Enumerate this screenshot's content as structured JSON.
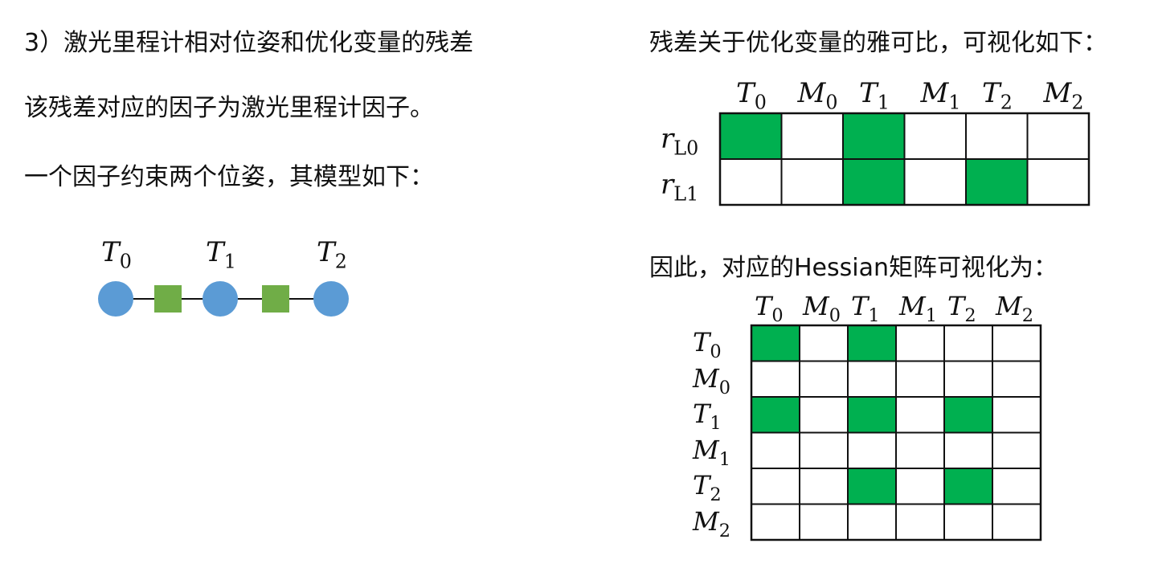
{
  "left": {
    "heading": "3）激光里程计相对位姿和优化变量的残差",
    "factor_line": "该残差对应的因子为激光里程计因子。",
    "model_line": "一个因子约束两个位姿，其模型如下："
  },
  "factor_graph": {
    "nodes": [
      {
        "sym": "T",
        "sub": "0"
      },
      {
        "sym": "T",
        "sub": "1"
      },
      {
        "sym": "T",
        "sub": "2"
      }
    ],
    "node_color": "#5b9bd5",
    "factor_color": "#70ad47"
  },
  "right": {
    "jacobian_title": "残差关于优化变量的雅可比，可视化如下：",
    "hessian_title": "因此，对应的Hessian矩阵可视化为："
  },
  "jacobian": {
    "columns": [
      {
        "sym": "T",
        "sub": "0"
      },
      {
        "sym": "M",
        "sub": "0"
      },
      {
        "sym": "T",
        "sub": "1"
      },
      {
        "sym": "M",
        "sub": "1"
      },
      {
        "sym": "T",
        "sub": "2"
      },
      {
        "sym": "M",
        "sub": "2"
      }
    ],
    "rows": [
      {
        "sym": "r",
        "sub": "L0"
      },
      {
        "sym": "r",
        "sub": "L1"
      }
    ],
    "filled": [
      [
        1,
        0,
        1,
        0,
        0,
        0
      ],
      [
        0,
        0,
        1,
        0,
        1,
        0
      ]
    ],
    "fill_color": "#00b050"
  },
  "hessian": {
    "columns": [
      {
        "sym": "T",
        "sub": "0"
      },
      {
        "sym": "M",
        "sub": "0"
      },
      {
        "sym": "T",
        "sub": "1"
      },
      {
        "sym": "M",
        "sub": "1"
      },
      {
        "sym": "T",
        "sub": "2"
      },
      {
        "sym": "M",
        "sub": "2"
      }
    ],
    "rows": [
      {
        "sym": "T",
        "sub": "0"
      },
      {
        "sym": "M",
        "sub": "0"
      },
      {
        "sym": "T",
        "sub": "1"
      },
      {
        "sym": "M",
        "sub": "1"
      },
      {
        "sym": "T",
        "sub": "2"
      },
      {
        "sym": "M",
        "sub": "2"
      }
    ],
    "filled": [
      [
        1,
        0,
        1,
        0,
        0,
        0
      ],
      [
        0,
        0,
        0,
        0,
        0,
        0
      ],
      [
        1,
        0,
        1,
        0,
        1,
        0
      ],
      [
        0,
        0,
        0,
        0,
        0,
        0
      ],
      [
        0,
        0,
        1,
        0,
        1,
        0
      ],
      [
        0,
        0,
        0,
        0,
        0,
        0
      ]
    ],
    "fill_color": "#00b050"
  }
}
